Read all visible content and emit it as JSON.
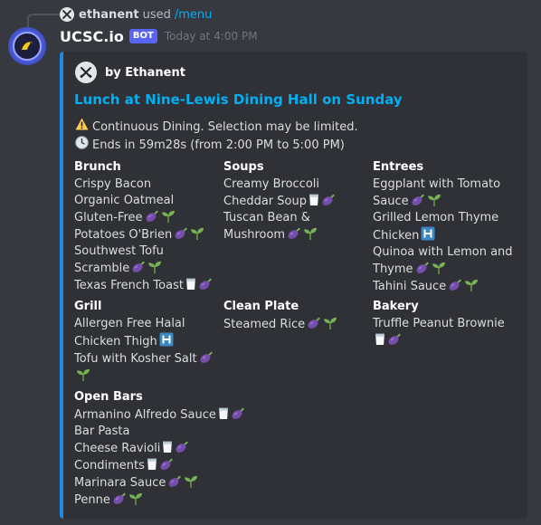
{
  "reply": {
    "username": "ethanent",
    "used": "used",
    "command": "/menu"
  },
  "message": {
    "bot_name": "UCSC.io",
    "bot_tag": "BOT",
    "timestamp": "Today at 4:00 PM"
  },
  "embed": {
    "accent_color": "#1e88e5",
    "author": "by Ethanent",
    "title": "Lunch at Nine-Lewis Dining Hall on Sunday",
    "notice_icon": "warning-icon",
    "notice": "Continuous Dining. Selection may be limited.",
    "time_icon": "clock-icon",
    "time_text": "Ends in 59m28s (from 2:00 PM to 5:00 PM)"
  },
  "fields": [
    {
      "name": "Brunch",
      "items": [
        {
          "label": "Crispy Bacon",
          "icons": []
        },
        {
          "label": "Organic Oatmeal Gluten-Free",
          "icons": [
            "eggplant-icon",
            "seedling-icon"
          ]
        },
        {
          "label": "Potatoes O'Brien",
          "icons": [
            "eggplant-icon",
            "seedling-icon"
          ]
        },
        {
          "label": "Southwest Tofu Scramble",
          "icons": [
            "eggplant-icon",
            "seedling-icon"
          ]
        },
        {
          "label": "Texas French Toast",
          "icons": [
            "milk-icon",
            "eggplant-icon"
          ]
        }
      ]
    },
    {
      "name": "Soups",
      "items": [
        {
          "label": "Creamy Broccoli Cheddar Soup",
          "icons": [
            "milk-icon",
            "eggplant-icon"
          ]
        },
        {
          "label": "Tuscan Bean & Mushroom",
          "icons": [
            "eggplant-icon",
            "seedling-icon"
          ]
        }
      ]
    },
    {
      "name": "Entrees",
      "items": [
        {
          "label": "Eggplant with Tomato Sauce",
          "icons": [
            "eggplant-icon",
            "seedling-icon"
          ]
        },
        {
          "label": "Grilled Lemon Thyme Chicken",
          "icons": [
            "halal-icon"
          ]
        },
        {
          "label": "Quinoa with Lemon and Thyme",
          "icons": [
            "eggplant-icon",
            "seedling-icon"
          ]
        },
        {
          "label": "Tahini Sauce",
          "icons": [
            "eggplant-icon",
            "seedling-icon"
          ]
        }
      ]
    },
    {
      "name": "Grill",
      "items": [
        {
          "label": "Allergen Free Halal Chicken Thigh",
          "icons": [
            "halal-icon"
          ]
        },
        {
          "label": "Tofu with Kosher Salt",
          "icons": [
            "eggplant-icon",
            "seedling-icon"
          ]
        }
      ]
    },
    {
      "name": "Clean Plate",
      "items": [
        {
          "label": "Steamed Rice",
          "icons": [
            "eggplant-icon",
            "seedling-icon"
          ]
        }
      ]
    },
    {
      "name": "Bakery",
      "items": [
        {
          "label": "Truffle Peanut Brownie",
          "icons": [
            "milk-icon",
            "eggplant-icon"
          ]
        }
      ]
    },
    {
      "name": "Open Bars",
      "items": [
        {
          "label": "Armanino Alfredo Sauce",
          "icons": [
            "milk-icon",
            "eggplant-icon"
          ]
        },
        {
          "label": "Bar Pasta",
          "icons": []
        },
        {
          "label": "Cheese Ravioli",
          "icons": [
            "milk-icon",
            "eggplant-icon"
          ]
        },
        {
          "label": "Condiments",
          "icons": [
            "milk-icon",
            "eggplant-icon"
          ]
        },
        {
          "label": "Marinara Sauce",
          "icons": [
            "eggplant-icon",
            "seedling-icon"
          ]
        },
        {
          "label": "Penne",
          "icons": [
            "eggplant-icon",
            "seedling-icon"
          ]
        }
      ]
    }
  ]
}
